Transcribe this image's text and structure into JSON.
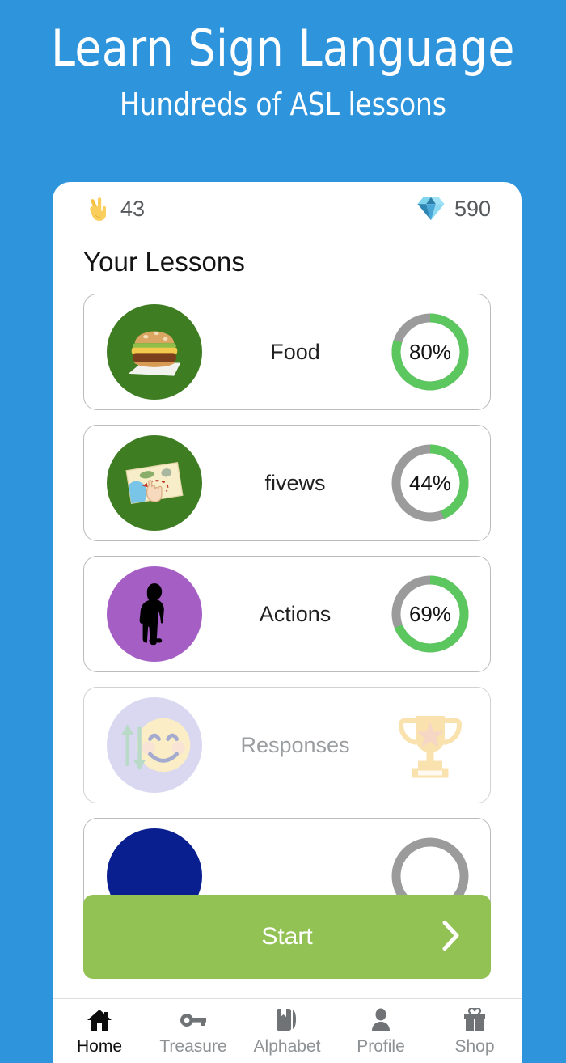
{
  "promo": {
    "title": "Learn Sign Language",
    "subtitle": "Hundreds of ASL lessons",
    "background_color": "#2e94dc"
  },
  "app": {
    "stats": [
      {
        "icon": "victory-hand-icon",
        "label": "lives",
        "value": "43"
      },
      {
        "icon": "gem-icon",
        "label": "gems",
        "value": "590"
      }
    ],
    "section_title": "Your Lessons",
    "lessons": [
      {
        "label": "Food",
        "icon": "hamburger-icon",
        "avatar_color": "#3e7d22",
        "progress": 80,
        "progress_text": "80%",
        "locked": false
      },
      {
        "label": "fivews",
        "icon": "world-map-icon",
        "avatar_color": "#3e7d22",
        "progress": 44,
        "progress_text": "44%",
        "locked": false
      },
      {
        "label": "Actions",
        "icon": "standing-person-icon",
        "avatar_color": "#a45ec4",
        "progress": 69,
        "progress_text": "69%",
        "locked": false
      },
      {
        "label": "Responses",
        "icon": "smiley-arrows-icon",
        "avatar_color": "#a5a3dd",
        "progress": null,
        "progress_text": "",
        "locked": true,
        "badge_icon": "trophy-icon"
      },
      {
        "label": "",
        "icon": "navy-circle-icon",
        "avatar_color": "#0a1f8f",
        "progress": 0,
        "progress_text": "",
        "locked": false
      }
    ],
    "start_button": {
      "label": "Start",
      "chevron_icon": "chevron-right-icon",
      "color": "#92c254"
    },
    "bottom_nav": [
      {
        "label": "Home",
        "icon": "home-icon",
        "active": true
      },
      {
        "label": "Treasure",
        "icon": "key-icon",
        "active": false
      },
      {
        "label": "Alphabet",
        "icon": "book-bookmark-icon",
        "active": false
      },
      {
        "label": "Profile",
        "icon": "person-icon",
        "active": false
      },
      {
        "label": "Shop",
        "icon": "gift-icon",
        "active": false
      }
    ]
  },
  "colors": {
    "ring_progress": "#5cc75f",
    "ring_track": "#9b9b9b",
    "accent_blue": "#2e94dc",
    "start_green": "#92c254"
  }
}
